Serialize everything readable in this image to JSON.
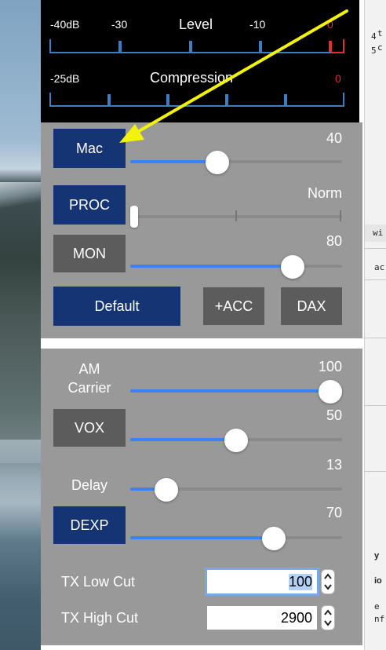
{
  "desktop": {
    "right_fragments": [
      "t",
      "c",
      "4",
      "5",
      "wi",
      "ac",
      "y",
      "io",
      "e",
      "nf"
    ]
  },
  "meter": {
    "level": {
      "title": "Level",
      "ticks": [
        "-40dB",
        "-30",
        "-10",
        "0"
      ],
      "level_red_tick": "0"
    },
    "compression": {
      "title": "Compression",
      "ticks": [
        "-25dB",
        "0"
      ]
    }
  },
  "tx": {
    "mic_button": "Mac",
    "mic_value": "40",
    "mic_level": 0.4,
    "proc_button": "PROC",
    "proc_value": "Norm",
    "mon_button": "MON",
    "mon_value": "80",
    "mon_level": 0.8,
    "default_button": "Default",
    "acc_button": "+ACC",
    "dax_button": "DAX"
  },
  "tx2": {
    "am_carrier_label": "AM\nCarrier",
    "am_carrier_value": "100",
    "am_carrier_level": 1.0,
    "vox_button": "VOX",
    "vox_value": "50",
    "vox_level": 0.5,
    "delay_label": "Delay",
    "delay_value": "13",
    "delay_level": 0.13,
    "dexp_button": "DEXP",
    "dexp_value": "70",
    "dexp_level": 0.7,
    "tx_low_cut_label": "TX Low Cut",
    "tx_low_cut_value": "100",
    "tx_high_cut_label": "TX High Cut",
    "tx_high_cut_value": "2900"
  },
  "colors": {
    "button_blue": "#153474",
    "button_gray": "#5c5c5c",
    "panel_gray": "#999999",
    "slider_fill": "#3b82f6",
    "meter_blue": "#3d7ec0",
    "meter_red": "#e03030",
    "annotation_arrow": "#f2f20a"
  }
}
